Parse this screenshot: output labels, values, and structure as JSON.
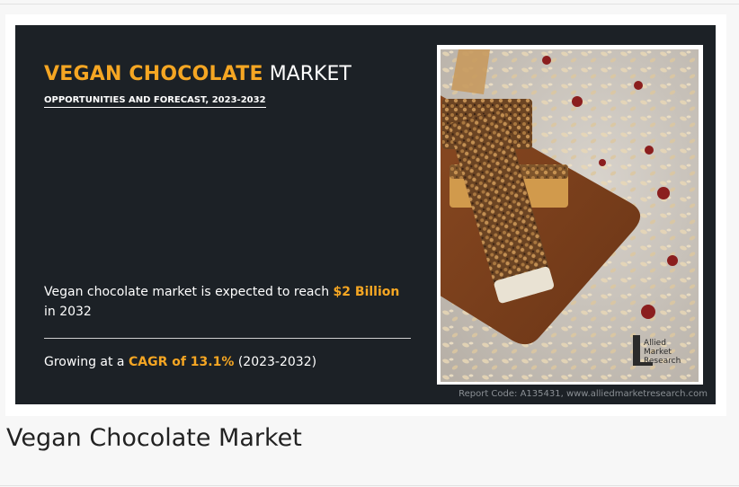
{
  "banner": {
    "title_accent": "VEGAN CHOCOLATE",
    "title_plain": "MARKET",
    "subtitle": "OPPORTUNITIES AND FORECAST, 2023-2032",
    "stat1": {
      "prefix": "Vegan chocolate market is expected to reach ",
      "value": "$2 Billion",
      "suffix": " in 2032"
    },
    "stat2": {
      "prefix": "Growing at a ",
      "value": "CAGR of 13.1%",
      "suffix": " (2023-2032)"
    },
    "report_code": "Report Code: A135431, www.alliedmarketresearch.com",
    "logo_lines": [
      "Allied",
      "Market",
      "Research"
    ]
  },
  "caption": "Vegan Chocolate Market",
  "colors": {
    "banner_bg": "#1c2126",
    "accent": "#f5a623",
    "page_bg": "#f7f7f7"
  }
}
